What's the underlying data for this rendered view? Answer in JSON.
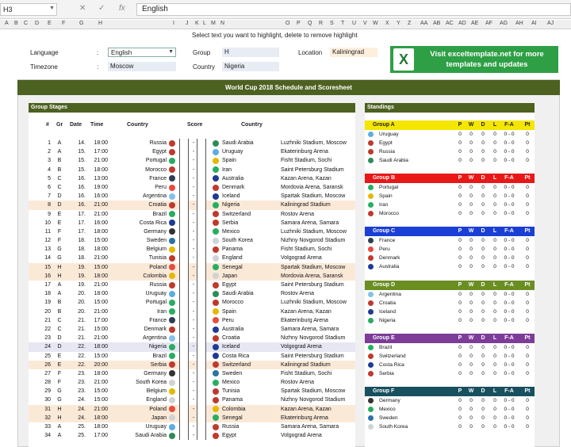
{
  "namebox": "H3",
  "formula": "English",
  "columns": [
    "A",
    "B",
    "C",
    "D",
    "E",
    "F",
    "G",
    "H",
    "I",
    "J",
    "K",
    "L",
    "M",
    "N",
    "O",
    "P",
    "Q",
    "R",
    "S",
    "T",
    "U",
    "V",
    "W",
    "X",
    "Y",
    "Z",
    "AA",
    "AB",
    "AC",
    "AD",
    "AE",
    "AF",
    "AG",
    "AH",
    "AI",
    "AJ"
  ],
  "hint": "Select text you want to highlight, delete to remove highlight",
  "settings": {
    "language_label": "Language",
    "language_value": "English",
    "timezone_label": "Timezone",
    "timezone_value": "Moscow",
    "colon": ":",
    "group_label": "Group",
    "group_value": "H",
    "country_label": "Country",
    "country_value": "Nigeria",
    "location_label": "Location",
    "location_value": "Kaliningrad"
  },
  "ad": {
    "line1": "Visit exceltemplate.net for more",
    "line2": "templates and updates"
  },
  "title": "World Cup 2018 Schedule and Scoresheet",
  "group_stages": {
    "header": "Group Stages",
    "cols": {
      "num": "#",
      "gr": "Gr",
      "date": "Date",
      "time": "Time",
      "country1": "Country",
      "score": "Score",
      "country2": "Country"
    },
    "dash": "-"
  },
  "matches": [
    [
      "1",
      "A",
      "14.",
      "18:00",
      "Russia",
      "Saudi Arabia",
      "Luzhniki Stadium, Moscow",
      "",
      "#c0392b",
      "#2e8b57"
    ],
    [
      "2",
      "A",
      "15.",
      "17:00",
      "Egypt",
      "Uruguay",
      "Ekaterinburg Arena",
      "",
      "#c0392b",
      "#5dade2"
    ],
    [
      "3",
      "B",
      "15.",
      "21:00",
      "Portugal",
      "Spain",
      "Fisht Stadium, Sochi",
      "",
      "#27ae60",
      "#e6b800"
    ],
    [
      "4",
      "B",
      "15.",
      "18:00",
      "Morocco",
      "Iran",
      "Saint Petersburg Stadium",
      "",
      "#c0392b",
      "#27ae60"
    ],
    [
      "5",
      "C",
      "16.",
      "13:00",
      "France",
      "Australia",
      "Kazan Arena, Kazan",
      "",
      "#2c3e50",
      "#1f3a93"
    ],
    [
      "6",
      "C",
      "16.",
      "19:00",
      "Peru",
      "Denmark",
      "Mordovia Arena, Saransk",
      "",
      "#e74c3c",
      "#c0392b"
    ],
    [
      "7",
      "D",
      "16.",
      "16:00",
      "Argentina",
      "Iceland",
      "Spartak Stadium, Moscow",
      "",
      "#85c1e9",
      "#1f3a93"
    ],
    [
      "8",
      "D",
      "16.",
      "21:00",
      "Croatia",
      "Nigeria",
      "Kaliningrad Stadium",
      "o",
      "#c0392b",
      "#27ae60"
    ],
    [
      "9",
      "E",
      "17.",
      "21:00",
      "Brazil",
      "Switzerland",
      "Rostov Arena",
      "",
      "#27ae60",
      "#c0392b"
    ],
    [
      "10",
      "E",
      "17.",
      "16:00",
      "Costa Rica",
      "Serbia",
      "Samara Arena, Samara",
      "",
      "#1f3a93",
      "#c0392b"
    ],
    [
      "11",
      "F",
      "17.",
      "18:00",
      "Germany",
      "Mexico",
      "Luzhniki Stadium, Moscow",
      "",
      "#333333",
      "#27ae60"
    ],
    [
      "12",
      "F",
      "18.",
      "15:00",
      "Sweden",
      "South Korea",
      "Nizhny Novgorod Stadium",
      "",
      "#2874a6",
      "#d0d3d4"
    ],
    [
      "13",
      "G",
      "18.",
      "18:00",
      "Belgium",
      "Panama",
      "Fisht Stadium, Sochi",
      "",
      "#e6b800",
      "#c0392b"
    ],
    [
      "14",
      "G",
      "18.",
      "21:00",
      "Tunisia",
      "England",
      "Volgograd Arena",
      "",
      "#c0392b",
      "#d0d3d4"
    ],
    [
      "15",
      "H",
      "19.",
      "15:00",
      "Poland",
      "Senegal",
      "Spartak Stadium, Moscow",
      "o",
      "#e74c3c",
      "#27ae60"
    ],
    [
      "16",
      "H",
      "19.",
      "18:00",
      "Colombia",
      "Japan",
      "Mordovia Arena, Saransk",
      "o",
      "#e6b800",
      "#d0d3d4"
    ],
    [
      "17",
      "A",
      "19.",
      "21:00",
      "Russia",
      "Egypt",
      "Saint Petersburg Stadium",
      "",
      "#c0392b",
      "#c0392b"
    ],
    [
      "18",
      "A",
      "20.",
      "18:00",
      "Uruguay",
      "Saudi Arabia",
      "Rostov Arena",
      "",
      "#5dade2",
      "#2e8b57"
    ],
    [
      "19",
      "B",
      "20.",
      "15:00",
      "Portugal",
      "Morocco",
      "Luzhniki Stadium, Moscow",
      "",
      "#27ae60",
      "#c0392b"
    ],
    [
      "20",
      "B",
      "20.",
      "21:00",
      "Iran",
      "Spain",
      "Kazan Arena, Kazan",
      "",
      "#27ae60",
      "#e6b800"
    ],
    [
      "21",
      "C",
      "21.",
      "17:00",
      "France",
      "Peru",
      "Ekaterinburg Arena",
      "",
      "#2c3e50",
      "#e74c3c"
    ],
    [
      "22",
      "C",
      "21.",
      "15:00",
      "Denmark",
      "Australia",
      "Samara Arena, Samara",
      "",
      "#c0392b",
      "#1f3a93"
    ],
    [
      "23",
      "D",
      "21.",
      "21:00",
      "Argentina",
      "Croatia",
      "Nizhny Novgorod Stadium",
      "",
      "#85c1e9",
      "#c0392b"
    ],
    [
      "24",
      "D",
      "22.",
      "18:00",
      "Nigeria",
      "Iceland",
      "Volgograd Arena",
      "b",
      "#27ae60",
      "#1f3a93"
    ],
    [
      "25",
      "E",
      "22.",
      "15:00",
      "Brazil",
      "Costa Rica",
      "Saint Petersburg Stadium",
      "",
      "#27ae60",
      "#1f3a93"
    ],
    [
      "26",
      "E",
      "22.",
      "20:00",
      "Serbia",
      "Switzerland",
      "Kaliningrad Stadium",
      "o",
      "#c0392b",
      "#c0392b"
    ],
    [
      "27",
      "F",
      "23.",
      "18:00",
      "Germany",
      "Sweden",
      "Fisht Stadium, Sochi",
      "",
      "#333333",
      "#2874a6"
    ],
    [
      "28",
      "F",
      "23.",
      "21:00",
      "South Korea",
      "Mexico",
      "Rostov Arena",
      "",
      "#d0d3d4",
      "#27ae60"
    ],
    [
      "29",
      "G",
      "23.",
      "15:00",
      "Belgium",
      "Tunisia",
      "Spartak Stadium, Moscow",
      "",
      "#e6b800",
      "#c0392b"
    ],
    [
      "30",
      "G",
      "24.",
      "15:00",
      "England",
      "Panama",
      "Nizhny Novgorod Stadium",
      "",
      "#d0d3d4",
      "#c0392b"
    ],
    [
      "31",
      "H",
      "24.",
      "21:00",
      "Poland",
      "Colombia",
      "Kazan Arena, Kazan",
      "o",
      "#e74c3c",
      "#e6b800"
    ],
    [
      "32",
      "H",
      "24.",
      "18:00",
      "Japan",
      "Senegal",
      "Ekaterinburg Arena",
      "o",
      "#d0d3d4",
      "#27ae60"
    ],
    [
      "33",
      "A",
      "25.",
      "18:00",
      "Uruguay",
      "Russia",
      "Samara Arena, Samara",
      "",
      "#5dade2",
      "#c0392b"
    ],
    [
      "34",
      "A",
      "25.",
      "17:00",
      "Saudi Arabia",
      "Egypt",
      "Volgograd Arena",
      "",
      "#2e8b57",
      "#c0392b"
    ]
  ],
  "standings": {
    "header": "Standings",
    "cols": [
      "P",
      "W",
      "D",
      "L",
      "F-A",
      "Pt"
    ],
    "zero": "0",
    "fa": "0 - 0",
    "groups": [
      {
        "name": "Group A",
        "color": "#f5e600",
        "text": "#222",
        "teams": [
          [
            "Uruguay",
            "#5dade2"
          ],
          [
            "Egypt",
            "#c0392b"
          ],
          [
            "Russia",
            "#c0392b"
          ],
          [
            "Saudi Arabia",
            "#2e8b57"
          ]
        ]
      },
      {
        "name": "Group B",
        "color": "#e81818",
        "text": "#fff",
        "teams": [
          [
            "Portugal",
            "#27ae60"
          ],
          [
            "Spain",
            "#e6b800"
          ],
          [
            "Iran",
            "#27ae60"
          ],
          [
            "Morocco",
            "#c0392b"
          ]
        ]
      },
      {
        "name": "Group C",
        "color": "#1a3fd6",
        "text": "#fff",
        "teams": [
          [
            "France",
            "#2c3e50"
          ],
          [
            "Peru",
            "#e74c3c"
          ],
          [
            "Denmark",
            "#c0392b"
          ],
          [
            "Australia",
            "#1f3a93"
          ]
        ]
      },
      {
        "name": "Group D",
        "color": "#6b8e23",
        "text": "#fff",
        "teams": [
          [
            "Argentina",
            "#85c1e9"
          ],
          [
            "Croatia",
            "#c0392b"
          ],
          [
            "Iceland",
            "#1f3a93"
          ],
          [
            "Nigeria",
            "#27ae60"
          ]
        ]
      },
      {
        "name": "Group E",
        "color": "#7d3c98",
        "text": "#fff",
        "teams": [
          [
            "Brazil",
            "#27ae60"
          ],
          [
            "Switzerland",
            "#c0392b"
          ],
          [
            "Costa Rica",
            "#1f3a93"
          ],
          [
            "Serbia",
            "#c0392b"
          ]
        ]
      },
      {
        "name": "Group F",
        "color": "#17505f",
        "text": "#fff",
        "teams": [
          [
            "Germany",
            "#333333"
          ],
          [
            "Mexico",
            "#27ae60"
          ],
          [
            "Sweden",
            "#2874a6"
          ],
          [
            "South Korea",
            "#d0d3d4"
          ]
        ]
      }
    ]
  }
}
